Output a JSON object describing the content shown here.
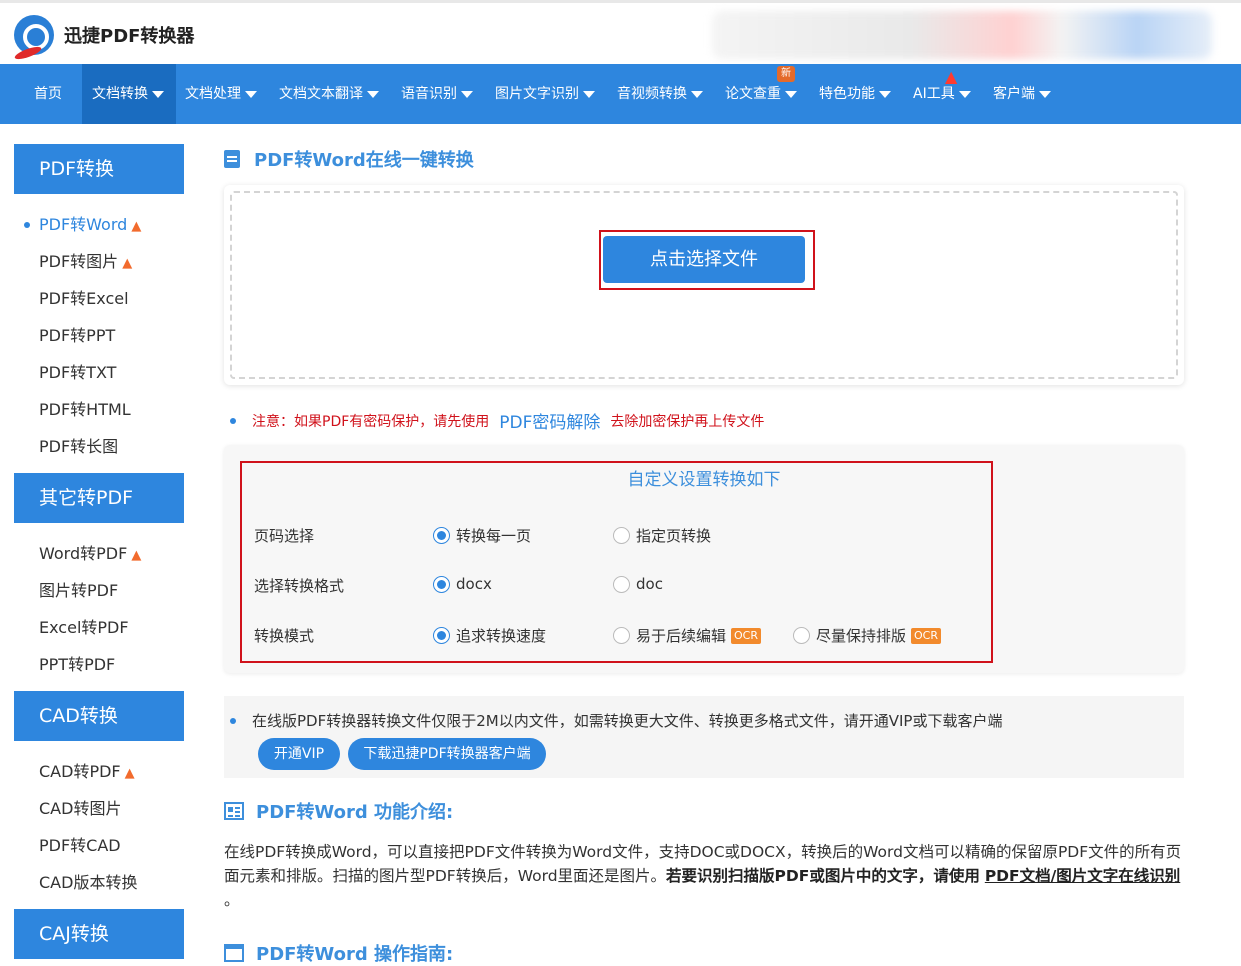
{
  "brand": {
    "name": "迅捷PDF转换器"
  },
  "nav": {
    "items": [
      {
        "label": "首页",
        "dropdown": false
      },
      {
        "label": "文档转换",
        "dropdown": true,
        "active": true
      },
      {
        "label": "文档处理",
        "dropdown": true
      },
      {
        "label": "文档文本翻译",
        "dropdown": true
      },
      {
        "label": "语音识别",
        "dropdown": true
      },
      {
        "label": "图片文字识别",
        "dropdown": true
      },
      {
        "label": "音视频转换",
        "dropdown": true
      },
      {
        "label": "论文查重",
        "dropdown": true,
        "badge": "新"
      },
      {
        "label": "特色功能",
        "dropdown": true
      },
      {
        "label": "AI工具",
        "dropdown": true,
        "hot": true
      },
      {
        "label": "客户端",
        "dropdown": true
      }
    ]
  },
  "sidebar": {
    "groups": [
      {
        "title": "PDF转换",
        "items": [
          {
            "label": "PDF转Word",
            "hot": true,
            "active": true
          },
          {
            "label": "PDF转图片",
            "hot": true
          },
          {
            "label": "PDF转Excel"
          },
          {
            "label": "PDF转PPT"
          },
          {
            "label": "PDF转TXT"
          },
          {
            "label": "PDF转HTML"
          },
          {
            "label": "PDF转长图"
          }
        ]
      },
      {
        "title": "其它转PDF",
        "items": [
          {
            "label": "Word转PDF",
            "hot": true
          },
          {
            "label": "图片转PDF"
          },
          {
            "label": "Excel转PDF"
          },
          {
            "label": "PPT转PDF"
          }
        ]
      },
      {
        "title": "CAD转换",
        "items": [
          {
            "label": "CAD转PDF",
            "hot": true
          },
          {
            "label": "CAD转图片"
          },
          {
            "label": "PDF转CAD"
          },
          {
            "label": "CAD版本转换"
          }
        ]
      },
      {
        "title": "CAJ转换",
        "items": []
      }
    ]
  },
  "main": {
    "title": "PDF转Word在线一键转换",
    "choose_file": "点击选择文件",
    "notice": {
      "prefix": "注意：如果PDF有密码保护，请先使用",
      "link": "PDF密码解除",
      "suffix": "去除加密保护再上传文件"
    },
    "settings": {
      "title": "自定义设置转换如下",
      "rows": [
        {
          "label": "页码选择",
          "options": [
            {
              "label": "转换每一页",
              "checked": true
            },
            {
              "label": "指定页转换",
              "checked": false
            }
          ]
        },
        {
          "label": "选择转换格式",
          "options": [
            {
              "label": "docx",
              "checked": true
            },
            {
              "label": "doc",
              "checked": false
            }
          ]
        },
        {
          "label": "转换模式",
          "options": [
            {
              "label": "追求转换速度",
              "checked": true
            },
            {
              "label": "易于后续编辑",
              "checked": false,
              "tag": "OCR"
            },
            {
              "label": "尽量保持排版",
              "checked": false,
              "tag": "OCR"
            }
          ]
        }
      ]
    },
    "limit": {
      "text": "在线版PDF转换器转换文件仅限于2M以内文件，如需转换更大文件、转换更多格式文件，请开通VIP或下载客户端",
      "vip_button": "开通VIP",
      "download_button": "下载迅捷PDF转换器客户端"
    },
    "intro": {
      "title": "PDF转Word 功能介绍:",
      "text": "在线PDF转换成Word，可以直接把PDF文件转换为Word文件，支持DOC或DOCX，转换后的Word文档可以精确的保留原PDF文件的所有页面元素和排版。扫描的图片型PDF转换后，Word里面还是图片。",
      "bold": "若要识别扫描版PDF或图片中的文字，请使用",
      "link": "PDF文档/图片文字在线识别",
      "end": "。"
    },
    "guide": {
      "title": "PDF转Word 操作指南:"
    }
  }
}
